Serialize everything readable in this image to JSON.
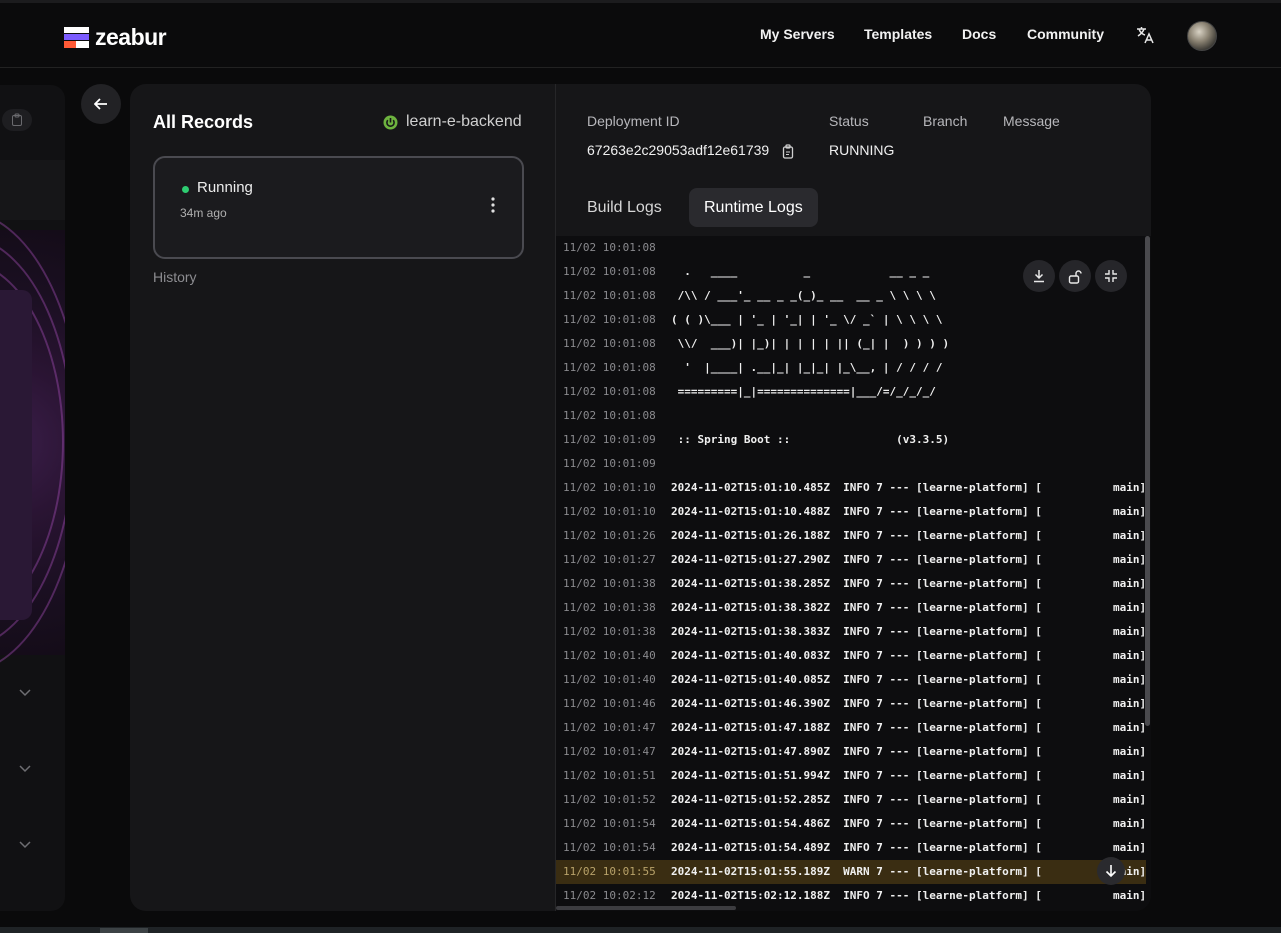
{
  "app": {
    "name": "zeabur"
  },
  "nav": {
    "items": [
      "My Servers",
      "Templates",
      "Docs",
      "Community"
    ],
    "icons": [
      "translate-icon",
      "avatar"
    ]
  },
  "records": {
    "title": "All Records",
    "service_name": "learn-e-backend",
    "service_icon": "spring-power-icon",
    "current": {
      "status": "Running",
      "age": "34m ago",
      "status_color": "#2ecc71"
    },
    "history_label": "History"
  },
  "deployment": {
    "labels": {
      "id": "Deployment ID",
      "status": "Status",
      "branch": "Branch",
      "message": "Message"
    },
    "id": "67263e2c29053adf12e61739",
    "status": "RUNNING"
  },
  "tabs": [
    {
      "label": "Build Logs",
      "active": false
    },
    {
      "label": "Runtime Logs",
      "active": true
    }
  ],
  "logs": [
    {
      "ts": "11/02 10:01:08",
      "msg": "",
      "tail": ""
    },
    {
      "ts": "11/02 10:01:08",
      "msg": "  .   ____          _            __ _ _",
      "tail": ""
    },
    {
      "ts": "11/02 10:01:08",
      "msg": " /\\\\ / ___'_ __ _ _(_)_ __  __ _ \\ \\ \\ \\",
      "tail": ""
    },
    {
      "ts": "11/02 10:01:08",
      "msg": "( ( )\\___ | '_ | '_| | '_ \\/ _` | \\ \\ \\ \\",
      "tail": ""
    },
    {
      "ts": "11/02 10:01:08",
      "msg": " \\\\/  ___)| |_)| | | | | || (_| |  ) ) ) )",
      "tail": ""
    },
    {
      "ts": "11/02 10:01:08",
      "msg": "  '  |____| .__|_| |_|_| |_\\__, | / / / /",
      "tail": ""
    },
    {
      "ts": "11/02 10:01:08",
      "msg": " =========|_|==============|___/=/_/_/_/",
      "tail": ""
    },
    {
      "ts": "11/02 10:01:08",
      "msg": "",
      "tail": ""
    },
    {
      "ts": "11/02 10:01:09",
      "msg": " :: Spring Boot ::                (v3.3.5)",
      "tail": ""
    },
    {
      "ts": "11/02 10:01:09",
      "msg": "",
      "tail": ""
    },
    {
      "ts": "11/02 10:01:10",
      "msg": "2024-11-02T15:01:10.485Z  INFO 7 --- [learne-platform] [",
      "tail": "main]"
    },
    {
      "ts": "11/02 10:01:10",
      "msg": "2024-11-02T15:01:10.488Z  INFO 7 --- [learne-platform] [",
      "tail": "main]"
    },
    {
      "ts": "11/02 10:01:26",
      "msg": "2024-11-02T15:01:26.188Z  INFO 7 --- [learne-platform] [",
      "tail": "main]"
    },
    {
      "ts": "11/02 10:01:27",
      "msg": "2024-11-02T15:01:27.290Z  INFO 7 --- [learne-platform] [",
      "tail": "main]"
    },
    {
      "ts": "11/02 10:01:38",
      "msg": "2024-11-02T15:01:38.285Z  INFO 7 --- [learne-platform] [",
      "tail": "main]"
    },
    {
      "ts": "11/02 10:01:38",
      "msg": "2024-11-02T15:01:38.382Z  INFO 7 --- [learne-platform] [",
      "tail": "main]"
    },
    {
      "ts": "11/02 10:01:38",
      "msg": "2024-11-02T15:01:38.383Z  INFO 7 --- [learne-platform] [",
      "tail": "main]"
    },
    {
      "ts": "11/02 10:01:40",
      "msg": "2024-11-02T15:01:40.083Z  INFO 7 --- [learne-platform] [",
      "tail": "main]"
    },
    {
      "ts": "11/02 10:01:40",
      "msg": "2024-11-02T15:01:40.085Z  INFO 7 --- [learne-platform] [",
      "tail": "main]"
    },
    {
      "ts": "11/02 10:01:46",
      "msg": "2024-11-02T15:01:46.390Z  INFO 7 --- [learne-platform] [",
      "tail": "main]"
    },
    {
      "ts": "11/02 10:01:47",
      "msg": "2024-11-02T15:01:47.188Z  INFO 7 --- [learne-platform] [",
      "tail": "main]"
    },
    {
      "ts": "11/02 10:01:47",
      "msg": "2024-11-02T15:01:47.890Z  INFO 7 --- [learne-platform] [",
      "tail": "main]"
    },
    {
      "ts": "11/02 10:01:51",
      "msg": "2024-11-02T15:01:51.994Z  INFO 7 --- [learne-platform] [",
      "tail": "main]"
    },
    {
      "ts": "11/02 10:01:52",
      "msg": "2024-11-02T15:01:52.285Z  INFO 7 --- [learne-platform] [",
      "tail": "main]"
    },
    {
      "ts": "11/02 10:01:54",
      "msg": "2024-11-02T15:01:54.486Z  INFO 7 --- [learne-platform] [",
      "tail": "main]"
    },
    {
      "ts": "11/02 10:01:54",
      "msg": "2024-11-02T15:01:54.489Z  INFO 7 --- [learne-platform] [",
      "tail": "main]"
    },
    {
      "ts": "11/02 10:01:55",
      "msg": "2024-11-02T15:01:55.189Z  WARN 7 --- [learne-platform] [",
      "tail": "main]",
      "level": "warn"
    },
    {
      "ts": "11/02 10:02:12",
      "msg": "2024-11-02T15:02:12.188Z  INFO 7 --- [learne-platform] [",
      "tail": "main]"
    }
  ],
  "log_tools": [
    "download-icon",
    "unlock-icon",
    "collapse-icon",
    "scroll-to-bottom-icon"
  ],
  "colors": {
    "background": "#0a0a0b",
    "panel": "#161618",
    "warn_row": "#3a2d12",
    "running": "#2ecc71"
  }
}
